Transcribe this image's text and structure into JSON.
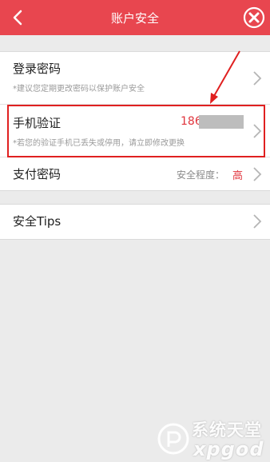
{
  "header": {
    "title": "账户安全"
  },
  "security_items": {
    "login_password": {
      "label": "登录密码",
      "hint": "*建议您定期更改密码以保护账户安全"
    },
    "phone_verify": {
      "label": "手机验证",
      "phone_prefix": "186",
      "hint": "*若您的验证手机已丢失或停用，请立即修改更换"
    },
    "pay_password": {
      "label": "支付密码",
      "level_label": "安全程度：",
      "level_value": "高"
    }
  },
  "tips_item": {
    "label": "安全Tips"
  },
  "watermark": {
    "line1": "系统天堂",
    "line2": "xpgod"
  },
  "colors": {
    "accent": "#e8464f",
    "highlight": "#e02020",
    "value_red": "#e0343c"
  },
  "icons": {
    "back": "chevron-left-icon",
    "close": "close-circle-icon",
    "row": "chevron-right-icon"
  }
}
